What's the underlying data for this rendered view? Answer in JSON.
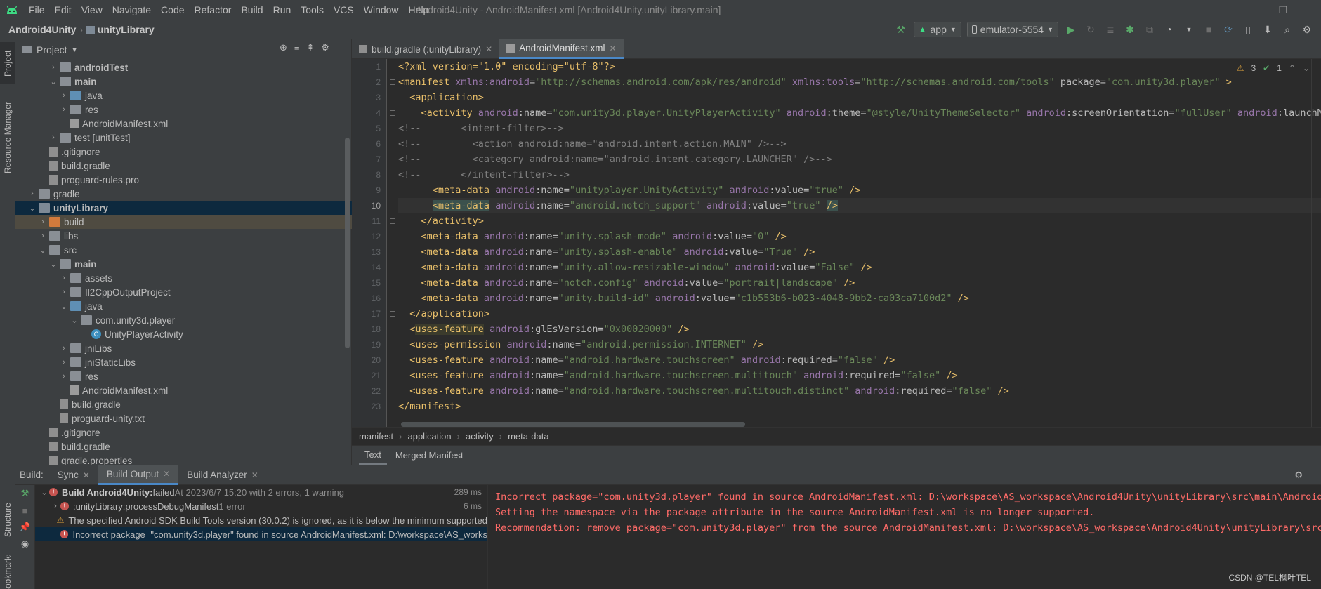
{
  "menubar": {
    "items": [
      "File",
      "Edit",
      "View",
      "Navigate",
      "Code",
      "Refactor",
      "Build",
      "Run",
      "Tools",
      "VCS",
      "Window",
      "Help"
    ],
    "title": "Android4Unity - AndroidManifest.xml [Android4Unity.unityLibrary.main]"
  },
  "navbar": {
    "project": "Android4Unity",
    "module": "unityLibrary",
    "run_config": "app",
    "device": "emulator-5554"
  },
  "left_stripe": {
    "project_tab": "Project",
    "resource_manager_tab": "Resource Manager",
    "structure_tab": "Structure",
    "bookmarks_tab": "Bookmarks"
  },
  "project_panel": {
    "title": "Project",
    "tree": [
      {
        "label": "androidTest",
        "indent": 3,
        "arrow": "›",
        "icon": "folder",
        "bold": true
      },
      {
        "label": "main",
        "indent": 3,
        "arrow": "⌄",
        "icon": "folder",
        "bold": true
      },
      {
        "label": "java",
        "indent": 4,
        "arrow": "›",
        "icon": "folder-blue",
        "bold": false
      },
      {
        "label": "res",
        "indent": 4,
        "arrow": "›",
        "icon": "folder",
        "bold": false
      },
      {
        "label": "AndroidManifest.xml",
        "indent": 4,
        "arrow": "",
        "icon": "xml",
        "bold": false
      },
      {
        "label": "test [unitTest]",
        "indent": 3,
        "arrow": "›",
        "icon": "folder",
        "bold": false
      },
      {
        "label": ".gitignore",
        "indent": 2,
        "arrow": "",
        "icon": "txt",
        "bold": false
      },
      {
        "label": "build.gradle",
        "indent": 2,
        "arrow": "",
        "icon": "txt",
        "bold": false
      },
      {
        "label": "proguard-rules.pro",
        "indent": 2,
        "arrow": "",
        "icon": "txt",
        "bold": false
      },
      {
        "label": "gradle",
        "indent": 1,
        "arrow": "›",
        "icon": "folder",
        "bold": false
      },
      {
        "label": "unityLibrary",
        "indent": 1,
        "arrow": "⌄",
        "icon": "folder-mod",
        "bold": true,
        "selected": "dark"
      },
      {
        "label": "build",
        "indent": 2,
        "arrow": "›",
        "icon": "folder-orange",
        "bold": false,
        "selected": "brown"
      },
      {
        "label": "libs",
        "indent": 2,
        "arrow": "›",
        "icon": "folder",
        "bold": false
      },
      {
        "label": "src",
        "indent": 2,
        "arrow": "⌄",
        "icon": "folder",
        "bold": false
      },
      {
        "label": "main",
        "indent": 3,
        "arrow": "⌄",
        "icon": "folder",
        "bold": true
      },
      {
        "label": "assets",
        "indent": 4,
        "arrow": "›",
        "icon": "folder",
        "bold": false
      },
      {
        "label": "Il2CppOutputProject",
        "indent": 4,
        "arrow": "›",
        "icon": "folder",
        "bold": false
      },
      {
        "label": "java",
        "indent": 4,
        "arrow": "⌄",
        "icon": "folder-blue",
        "bold": false
      },
      {
        "label": "com.unity3d.player",
        "indent": 5,
        "arrow": "⌄",
        "icon": "folder",
        "bold": false
      },
      {
        "label": "UnityPlayerActivity",
        "indent": 6,
        "arrow": "",
        "icon": "class",
        "bold": false
      },
      {
        "label": "jniLibs",
        "indent": 4,
        "arrow": "›",
        "icon": "folder",
        "bold": false
      },
      {
        "label": "jniStaticLibs",
        "indent": 4,
        "arrow": "›",
        "icon": "folder",
        "bold": false
      },
      {
        "label": "res",
        "indent": 4,
        "arrow": "›",
        "icon": "folder",
        "bold": false
      },
      {
        "label": "AndroidManifest.xml",
        "indent": 4,
        "arrow": "",
        "icon": "xml",
        "bold": false
      },
      {
        "label": "build.gradle",
        "indent": 3,
        "arrow": "",
        "icon": "txt",
        "bold": false
      },
      {
        "label": "proguard-unity.txt",
        "indent": 3,
        "arrow": "",
        "icon": "txt",
        "bold": false
      },
      {
        "label": ".gitignore",
        "indent": 2,
        "arrow": "",
        "icon": "txt",
        "bold": false
      },
      {
        "label": "build.gradle",
        "indent": 2,
        "arrow": "",
        "icon": "txt",
        "bold": false
      },
      {
        "label": "gradle.properties",
        "indent": 2,
        "arrow": "",
        "icon": "txt",
        "bold": false
      }
    ]
  },
  "editor_tabs": [
    {
      "label": "build.gradle (:unityLibrary)",
      "active": false
    },
    {
      "label": "AndroidManifest.xml",
      "active": true
    }
  ],
  "editor": {
    "inspection_warnings": "3",
    "inspection_weak": "1",
    "current_line": 10,
    "lines": [
      [
        [
          "pi",
          "<?xml version=\"1.0\" encoding=\"utf-8\"?>"
        ]
      ],
      [
        [
          "tag",
          "<manifest "
        ],
        [
          "ns",
          "xmlns:android"
        ],
        [
          "attr",
          "="
        ],
        [
          "str",
          "\"http://schemas.android.com/apk/res/android\""
        ],
        [
          "attr",
          " "
        ],
        [
          "ns",
          "xmlns:tools"
        ],
        [
          "attr",
          "="
        ],
        [
          "str",
          "\"http://schemas.android.com/tools\""
        ],
        [
          "attr",
          " package="
        ],
        [
          "str",
          "\"com.unity3d.player\""
        ],
        [
          "tag",
          " >"
        ]
      ],
      [
        [
          "attr",
          "  "
        ],
        [
          "tag",
          "<application>"
        ]
      ],
      [
        [
          "attr",
          "    "
        ],
        [
          "tag",
          "<activity "
        ],
        [
          "ns",
          "android"
        ],
        [
          "attr",
          ":name="
        ],
        [
          "str",
          "\"com.unity3d.player.UnityPlayerActivity\""
        ],
        [
          "attr",
          " "
        ],
        [
          "ns",
          "android"
        ],
        [
          "attr",
          ":theme="
        ],
        [
          "str",
          "\"@style/UnityThemeSelector\""
        ],
        [
          "attr",
          " "
        ],
        [
          "ns",
          "android"
        ],
        [
          "attr",
          ":screenOrientation="
        ],
        [
          "str",
          "\"fullUser\""
        ],
        [
          "attr",
          " "
        ],
        [
          "ns",
          "android"
        ],
        [
          "attr",
          ":launchMode"
        ]
      ],
      [
        [
          "cmt",
          "<!--       <intent-filter>-->"
        ]
      ],
      [
        [
          "cmt",
          "<!--         <action android:name=\"android.intent.action.MAIN\" />-->"
        ]
      ],
      [
        [
          "cmt",
          "<!--         <category android:name=\"android.intent.category.LAUNCHER\" />-->"
        ]
      ],
      [
        [
          "cmt",
          "<!--       </intent-filter>-->"
        ]
      ],
      [
        [
          "attr",
          "      "
        ],
        [
          "tag",
          "<meta-data "
        ],
        [
          "ns",
          "android"
        ],
        [
          "attr",
          ":name="
        ],
        [
          "str",
          "\"unityplayer.UnityActivity\""
        ],
        [
          "attr",
          " "
        ],
        [
          "ns",
          "android"
        ],
        [
          "attr",
          ":value="
        ],
        [
          "str",
          "\"true\""
        ],
        [
          "tag",
          " />"
        ]
      ],
      [
        [
          "attr",
          "      "
        ],
        [
          "taghl",
          "<meta-data"
        ],
        [
          "attr",
          " "
        ],
        [
          "ns",
          "android"
        ],
        [
          "attr",
          ":name="
        ],
        [
          "str",
          "\"android.notch_support\""
        ],
        [
          "attr",
          " "
        ],
        [
          "ns",
          "android"
        ],
        [
          "attr",
          ":value="
        ],
        [
          "str",
          "\"true\""
        ],
        [
          "attr",
          " "
        ],
        [
          "taghl",
          "/>"
        ]
      ],
      [
        [
          "attr",
          "    "
        ],
        [
          "tag",
          "</activity>"
        ]
      ],
      [
        [
          "attr",
          "    "
        ],
        [
          "tag",
          "<meta-data "
        ],
        [
          "ns",
          "android"
        ],
        [
          "attr",
          ":name="
        ],
        [
          "str",
          "\"unity.splash-mode\""
        ],
        [
          "attr",
          " "
        ],
        [
          "ns",
          "android"
        ],
        [
          "attr",
          ":value="
        ],
        [
          "str",
          "\"0\""
        ],
        [
          "tag",
          " />"
        ]
      ],
      [
        [
          "attr",
          "    "
        ],
        [
          "tag",
          "<meta-data "
        ],
        [
          "ns",
          "android"
        ],
        [
          "attr",
          ":name="
        ],
        [
          "str",
          "\"unity.splash-enable\""
        ],
        [
          "attr",
          " "
        ],
        [
          "ns",
          "android"
        ],
        [
          "attr",
          ":value="
        ],
        [
          "str",
          "\"True\""
        ],
        [
          "tag",
          " />"
        ]
      ],
      [
        [
          "attr",
          "    "
        ],
        [
          "tag",
          "<meta-data "
        ],
        [
          "ns",
          "android"
        ],
        [
          "attr",
          ":name="
        ],
        [
          "str",
          "\"unity.allow-resizable-window\""
        ],
        [
          "attr",
          " "
        ],
        [
          "ns",
          "android"
        ],
        [
          "attr",
          ":value="
        ],
        [
          "str",
          "\"False\""
        ],
        [
          "tag",
          " />"
        ]
      ],
      [
        [
          "attr",
          "    "
        ],
        [
          "tag",
          "<meta-data "
        ],
        [
          "ns",
          "android"
        ],
        [
          "attr",
          ":name="
        ],
        [
          "str",
          "\"notch.config\""
        ],
        [
          "attr",
          " "
        ],
        [
          "ns",
          "android"
        ],
        [
          "attr",
          ":value="
        ],
        [
          "str",
          "\"portrait|landscape\""
        ],
        [
          "tag",
          " />"
        ]
      ],
      [
        [
          "attr",
          "    "
        ],
        [
          "tag",
          "<meta-data "
        ],
        [
          "ns",
          "android"
        ],
        [
          "attr",
          ":name="
        ],
        [
          "str",
          "\"unity.build-id\""
        ],
        [
          "attr",
          " "
        ],
        [
          "ns",
          "android"
        ],
        [
          "attr",
          ":value="
        ],
        [
          "str",
          "\"c1b553b6-b023-4048-9bb2-ca03ca7100d2\""
        ],
        [
          "tag",
          " />"
        ]
      ],
      [
        [
          "attr",
          "  "
        ],
        [
          "tag",
          "</application>"
        ]
      ],
      [
        [
          "attr",
          "  "
        ],
        [
          "tag",
          "<"
        ],
        [
          "taguf",
          "uses-feature"
        ],
        [
          "attr",
          " "
        ],
        [
          "ns",
          "android"
        ],
        [
          "attr",
          ":glEsVersion="
        ],
        [
          "str",
          "\"0x00020000\""
        ],
        [
          "tag",
          " />"
        ]
      ],
      [
        [
          "attr",
          "  "
        ],
        [
          "tag",
          "<uses-permission "
        ],
        [
          "ns",
          "android"
        ],
        [
          "attr",
          ":name="
        ],
        [
          "str",
          "\"android.permission.INTERNET\""
        ],
        [
          "tag",
          " />"
        ]
      ],
      [
        [
          "attr",
          "  "
        ],
        [
          "tag",
          "<uses-feature "
        ],
        [
          "ns",
          "android"
        ],
        [
          "attr",
          ":name="
        ],
        [
          "str",
          "\"android.hardware.touchscreen\""
        ],
        [
          "attr",
          " "
        ],
        [
          "ns",
          "android"
        ],
        [
          "attr",
          ":required="
        ],
        [
          "str",
          "\"false\""
        ],
        [
          "tag",
          " />"
        ]
      ],
      [
        [
          "attr",
          "  "
        ],
        [
          "tag",
          "<uses-feature "
        ],
        [
          "ns",
          "android"
        ],
        [
          "attr",
          ":name="
        ],
        [
          "str",
          "\"android.hardware.touchscreen.multitouch\""
        ],
        [
          "attr",
          " "
        ],
        [
          "ns",
          "android"
        ],
        [
          "attr",
          ":required="
        ],
        [
          "str",
          "\"false\""
        ],
        [
          "tag",
          " />"
        ]
      ],
      [
        [
          "attr",
          "  "
        ],
        [
          "tag",
          "<uses-feature "
        ],
        [
          "ns",
          "android"
        ],
        [
          "attr",
          ":name="
        ],
        [
          "str",
          "\"android.hardware.touchscreen.multitouch.distinct\""
        ],
        [
          "attr",
          " "
        ],
        [
          "ns",
          "android"
        ],
        [
          "attr",
          ":required="
        ],
        [
          "str",
          "\"false\""
        ],
        [
          "tag",
          " />"
        ]
      ],
      [
        [
          "tag",
          "</manifest>"
        ]
      ]
    ]
  },
  "xml_breadcrumbs": [
    "manifest",
    "application",
    "activity",
    "meta-data"
  ],
  "view_tabs": [
    {
      "label": "Text",
      "active": true
    },
    {
      "label": "Merged Manifest",
      "active": false
    }
  ],
  "build_panel": {
    "label": "Build:",
    "tabs": [
      {
        "label": "Sync",
        "active": false
      },
      {
        "label": "Build Output",
        "active": true
      },
      {
        "label": "Build Analyzer",
        "active": false
      }
    ],
    "tree": [
      {
        "bold": "Build Android4Unity:",
        "text": " failed",
        "dim": " At 2023/6/7 15:20 with 2 errors, 1 warning",
        "time": "289 ms",
        "type": "error",
        "indent": 0,
        "arrow": "⌄"
      },
      {
        "bold": "",
        "text": ":unityLibrary:processDebugManifest",
        "dim": "  1 error",
        "time": "6 ms",
        "type": "error",
        "indent": 1,
        "arrow": "›"
      },
      {
        "bold": "",
        "text": "The specified Android SDK Build Tools version (30.0.2) is ignored, as it is below the minimum supported",
        "dim": "",
        "time": "",
        "type": "warning",
        "indent": 1,
        "arrow": ""
      },
      {
        "bold": "",
        "text": "Incorrect package=\"com.unity3d.player\" found in source AndroidManifest.xml: D:\\workspace\\AS_works",
        "dim": "",
        "time": "",
        "type": "error",
        "indent": 1,
        "arrow": "",
        "selected": true
      }
    ],
    "console": [
      "Incorrect package=\"com.unity3d.player\" found in source AndroidManifest.xml: D:\\workspace\\AS_workspace\\Android4Unity\\unityLibrary\\src\\main\\AndroidMa",
      "Setting the namespace via the package attribute in the source AndroidManifest.xml is no longer supported.",
      "Recommendation: remove package=\"com.unity3d.player\" from the source AndroidManifest.xml: D:\\workspace\\AS_workspace\\Android4Unity\\unityLibrary\\src\\"
    ]
  },
  "watermark": "CSDN @TEL枫叶TEL",
  "colors": {
    "accent": "#4a88c7",
    "error": "#c75450",
    "console_error": "#ff6b68",
    "warning": "#e0a43d",
    "run_green": "#59a869"
  }
}
